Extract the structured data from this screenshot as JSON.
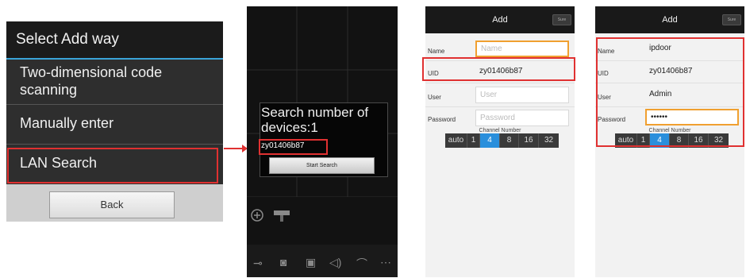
{
  "screen1": {
    "title": "Select Add way",
    "options": [
      "Two-dimensional code\nscanning",
      "Manually enter",
      "LAN Search"
    ],
    "back_label": "Back"
  },
  "screen2": {
    "dialog_title": "Search number of devices:1",
    "found_uid": "zy01406b87",
    "start_button": "Start Search"
  },
  "screen3": {
    "title": "Add",
    "sure_label": "Sure",
    "fields": {
      "name_label": "Name",
      "name_placeholder": "Name",
      "uid_label": "UID",
      "uid_value": "zy01406b87",
      "user_label": "User",
      "user_placeholder": "User",
      "password_label": "Password",
      "password_placeholder": "Password"
    },
    "channel_label": "Channel Number",
    "channels": [
      "auto",
      "1",
      "4",
      "8",
      "16",
      "32"
    ],
    "active_channel": "4"
  },
  "screen4": {
    "title": "Add",
    "sure_label": "Sure",
    "fields": {
      "name_label": "Name",
      "name_value": "ipdoor",
      "uid_label": "UID",
      "uid_value": "zy01406b87",
      "user_label": "User",
      "user_value": "Admin",
      "password_label": "Password",
      "password_value": "••••••"
    },
    "channel_label": "Channel Number",
    "channels": [
      "auto",
      "1",
      "4",
      "8",
      "16",
      "32"
    ],
    "active_channel": "4"
  },
  "colors": {
    "highlight": "#e03131",
    "accent": "#2a8fdc",
    "focus": "#f0a030"
  }
}
